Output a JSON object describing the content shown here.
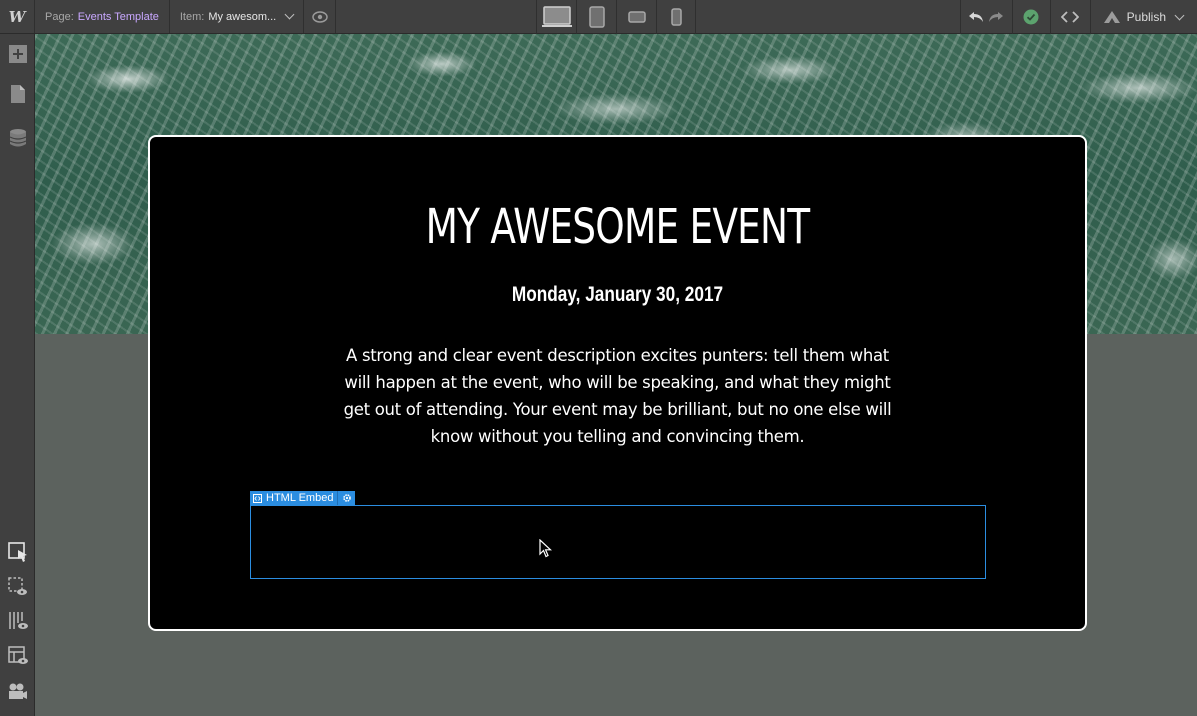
{
  "topbar": {
    "logo": "W",
    "page_label": "Page:",
    "page_value": "Events Template",
    "item_label": "Item:",
    "item_value": "My awesom...",
    "publish_label": "Publish"
  },
  "devices": [
    "desktop-icon",
    "tablet-icon",
    "mobile-landscape-icon",
    "mobile-portrait-icon"
  ],
  "event": {
    "title": "MY AWESOME EVENT",
    "date": "Monday, January 30, 2017",
    "description": "A strong and clear event description excites punters: tell them what will happen at the event, who will be speaking, and what they might get out of attending. Your event may be brilliant, but no one else will know without you telling and convincing them."
  },
  "embed": {
    "label": "HTML Embed"
  },
  "colors": {
    "accent": "#2b8de0",
    "link": "#c9a8ff",
    "status_ok": "#5ca36e",
    "chrome": "#404040",
    "canvas": "#5c625e"
  }
}
